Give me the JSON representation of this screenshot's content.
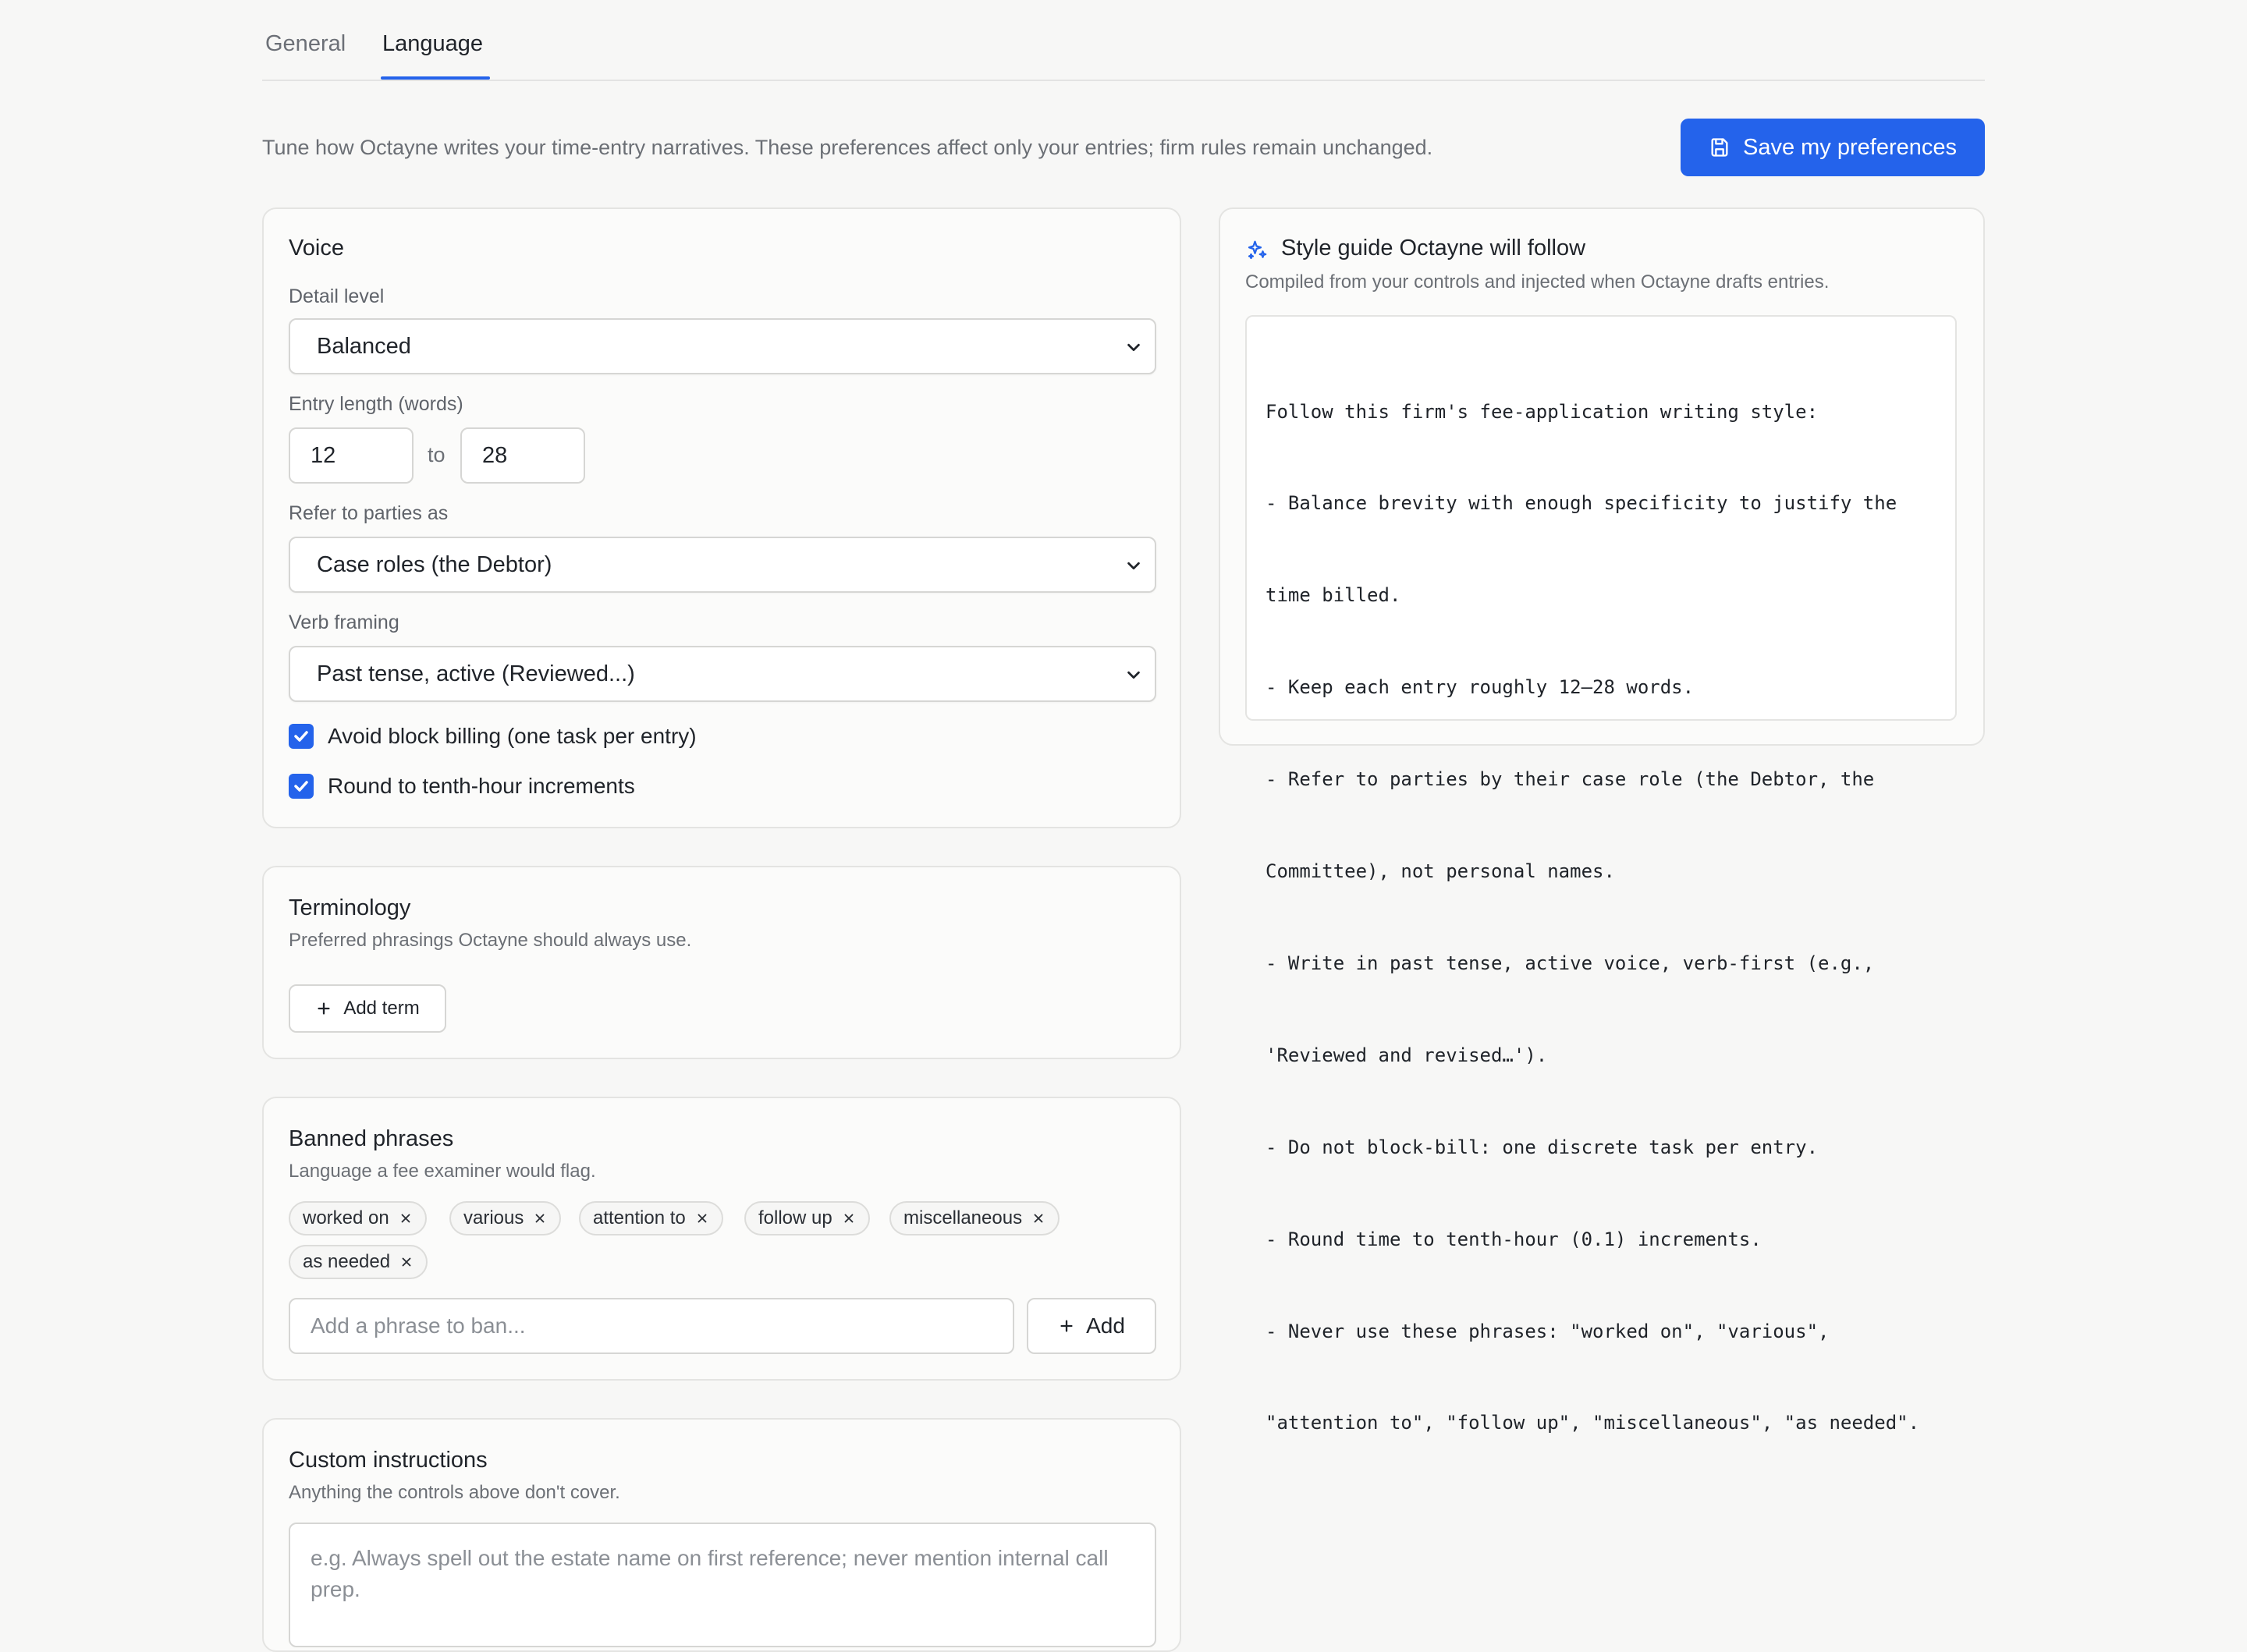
{
  "tabs": [
    {
      "label": "General",
      "active": false
    },
    {
      "label": "Language",
      "active": true
    }
  ],
  "intro": "Tune how Octayne writes your time-entry narratives. These preferences affect only your entries; firm rules remain unchanged.",
  "save_button": {
    "label": "Save my preferences",
    "icon": "save-icon"
  },
  "accent_color": "#2463eb",
  "voice": {
    "title": "Voice",
    "detail_level_label": "Detail level",
    "detail_level_value": "Balanced",
    "entry_length_label": "Entry length (words)",
    "entry_length_min": "12",
    "entry_length_to": "to",
    "entry_length_max": "28",
    "parties_label": "Refer to parties as",
    "parties_value": "Case roles (the Debtor)",
    "verb_label": "Verb framing",
    "verb_value": "Past tense, active (Reviewed...)",
    "checkboxes": [
      {
        "label": "Avoid block billing (one task per entry)",
        "checked": true
      },
      {
        "label": "Round to tenth-hour increments",
        "checked": true
      }
    ]
  },
  "terminology": {
    "title": "Terminology",
    "subtitle": "Preferred phrasings Octayne should always use.",
    "add_label": "Add term"
  },
  "banned": {
    "title": "Banned phrases",
    "subtitle": "Language a fee examiner would flag.",
    "chips": [
      "worked on",
      "various",
      "attention to",
      "follow up",
      "miscellaneous",
      "as needed"
    ],
    "input_placeholder": "Add a phrase to ban...",
    "add_label": "Add"
  },
  "custom": {
    "title": "Custom instructions",
    "subtitle": "Anything the controls above don't cover.",
    "placeholder": "e.g. Always spell out the estate name on first reference; never mention internal call prep."
  },
  "style_guide": {
    "title": "Style guide Octayne will follow",
    "subtitle": "Compiled from your controls and injected when Octayne drafts entries.",
    "icon": "sparkles-icon",
    "lines": [
      "Follow this firm's fee-application writing style:",
      "- Balance brevity with enough specificity to justify the",
      "time billed.",
      "- Keep each entry roughly 12–28 words.",
      "- Refer to parties by their case role (the Debtor, the",
      "Committee), not personal names.",
      "- Write in past tense, active voice, verb-first (e.g.,",
      "'Reviewed and revised…').",
      "- Do not block-bill: one discrete task per entry.",
      "- Round time to tenth-hour (0.1) increments.",
      "- Never use these phrases: \"worked on\", \"various\",",
      "\"attention to\", \"follow up\", \"miscellaneous\", \"as needed\"."
    ]
  }
}
